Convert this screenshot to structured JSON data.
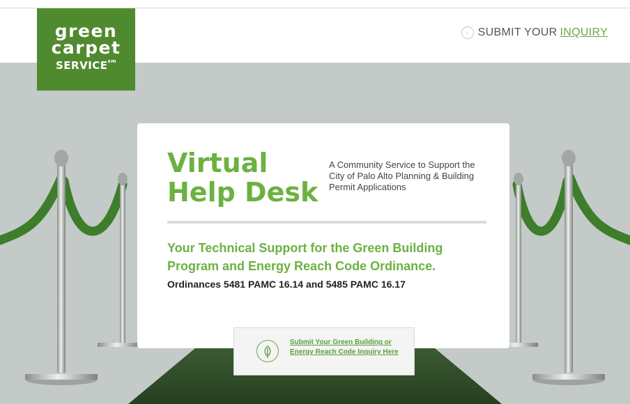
{
  "header": {
    "logo": {
      "line1": "green",
      "line2": "carpet",
      "line3": "SERVICE",
      "mark": "sm"
    },
    "inquiry": {
      "icon": "chevron-right-circle-icon",
      "prefix": "SUBMIT YOUR",
      "link": "INQUIRY"
    }
  },
  "hero": {
    "title_line1": "Virtual",
    "title_line2": "Help Desk",
    "subtitle": "A Community Service to Support the City of Palo Alto Planning & Building Permit Applications",
    "description_green": "Your Technical Support for the Green Building Program and Energy Reach Code Ordinance.",
    "description_black": "Ordinances 5481 PAMC 16.14 and 5485 PAMC 16.17"
  },
  "cta": {
    "icon": "leaf-icon",
    "label": "Submit Your Green Building or Energy Reach Code Inquiry Here"
  },
  "colors": {
    "brand_green": "#4f8a2f",
    "accent_green": "#6cb141",
    "backdrop": "#c3cac7",
    "carpet": "#2f4a2a"
  }
}
